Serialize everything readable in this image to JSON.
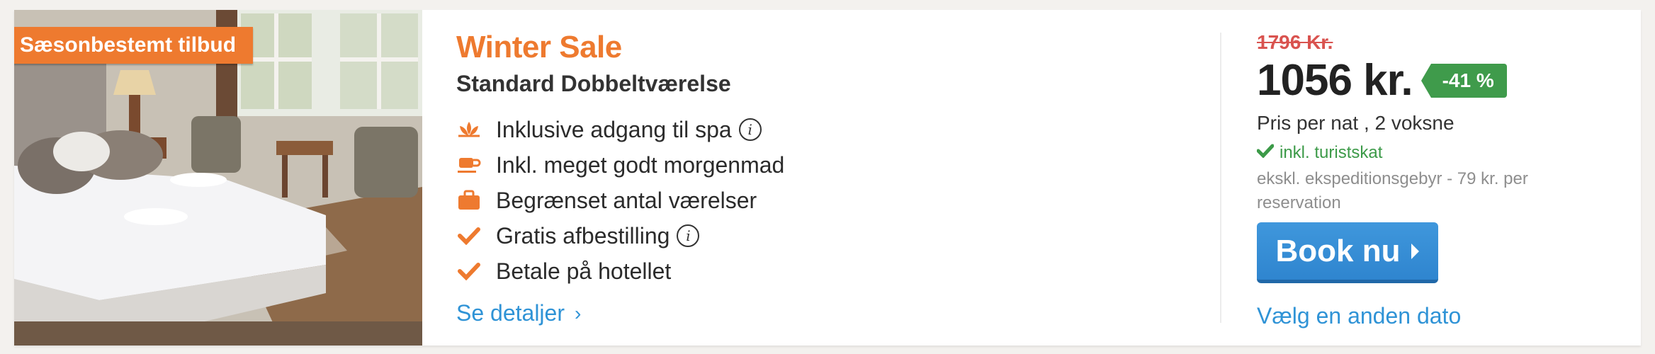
{
  "badge": "Sæsonbestemt tilbud",
  "deal": {
    "title": "Winter Sale",
    "room": "Standard Dobbeltværelse",
    "features": [
      {
        "label": "Inklusive adgang til spa",
        "icon": "spa-lotus-icon",
        "info": true
      },
      {
        "label": "Inkl. meget godt morgenmad",
        "icon": "coffee-cup-icon",
        "info": false
      },
      {
        "label": "Begrænset antal værelser",
        "icon": "briefcase-icon",
        "info": false
      },
      {
        "label": "Gratis afbestilling",
        "icon": "check-icon",
        "info": true
      },
      {
        "label": "Betale på hotellet",
        "icon": "check-icon",
        "info": false
      }
    ],
    "details_link": "Se detaljer",
    "details_chevron": "›"
  },
  "pricing": {
    "old_price": "1796 Kr.",
    "price": "1056 kr.",
    "discount": "-41 %",
    "per_night": "Pris per nat , 2 voksne",
    "tax_note": "inkl. turistskat",
    "fee_note": "ekskl. ekspeditionsgebyr - 79 kr. per reservation",
    "book_label": "Book nu",
    "other_date": "Vælg en anden dato"
  },
  "info_glyph": "i",
  "colors": {
    "accent_orange": "#ee7a2f",
    "link_blue": "#2f93d6",
    "button_blue": "#3a8fd6",
    "discount_green": "#3f9b4b",
    "old_price_red": "#d9534f"
  }
}
